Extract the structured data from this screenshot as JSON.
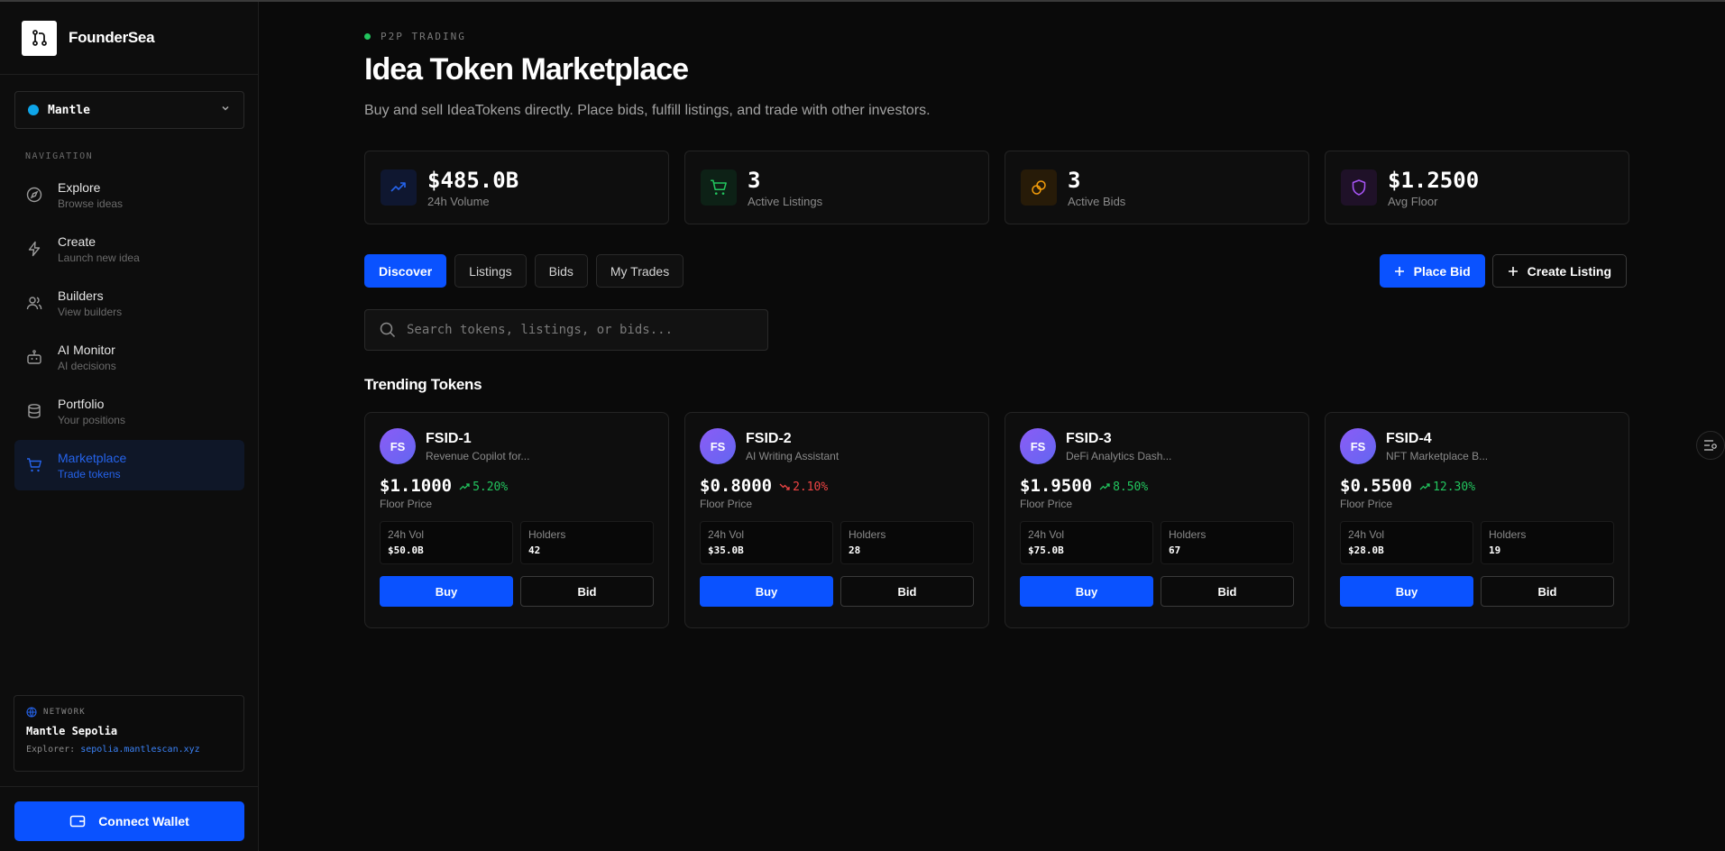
{
  "brand": {
    "name": "FounderSea"
  },
  "chain_selector": {
    "value": "Mantle"
  },
  "navigation": {
    "heading": "NAVIGATION",
    "items": [
      {
        "label": "Explore",
        "sub": "Browse ideas",
        "icon": "compass-icon"
      },
      {
        "label": "Create",
        "sub": "Launch new idea",
        "icon": "bolt-icon"
      },
      {
        "label": "Builders",
        "sub": "View builders",
        "icon": "users-icon"
      },
      {
        "label": "AI Monitor",
        "sub": "AI decisions",
        "icon": "robot-icon"
      },
      {
        "label": "Portfolio",
        "sub": "Your positions",
        "icon": "database-icon"
      },
      {
        "label": "Marketplace",
        "sub": "Trade tokens",
        "icon": "cart-icon"
      }
    ]
  },
  "network": {
    "title": "NETWORK",
    "name": "Mantle Sepolia",
    "explorer_label": "Explorer:",
    "explorer_link": "sepolia.mantlescan.xyz"
  },
  "wallet": {
    "label": "Connect Wallet"
  },
  "page": {
    "eyebrow": "P2P TRADING",
    "title": "Idea Token Marketplace",
    "description": "Buy and sell IdeaTokens directly. Place bids, fulfill listings, and trade with other investors."
  },
  "stats": [
    {
      "value": "$485.0B",
      "label": "24h Volume",
      "icon": "trend-up-icon",
      "color": "#2563eb"
    },
    {
      "value": "3",
      "label": "Active Listings",
      "icon": "cart-icon",
      "color": "#22c55e"
    },
    {
      "value": "3",
      "label": "Active Bids",
      "icon": "coins-icon",
      "color": "#f59e0b"
    },
    {
      "value": "$1.2500",
      "label": "Avg Floor",
      "icon": "shield-icon",
      "color": "#a855f7"
    }
  ],
  "tabs": [
    "Discover",
    "Listings",
    "Bids",
    "My Trades"
  ],
  "actions": {
    "place_bid": "Place Bid",
    "create_listing": "Create Listing"
  },
  "search": {
    "placeholder": "Search tokens, listings, or bids..."
  },
  "trending": {
    "title": "Trending Tokens",
    "floor_label": "Floor Price",
    "vol_label": "24h Vol",
    "holders_label": "Holders",
    "buy_label": "Buy",
    "bid_label": "Bid",
    "tokens": [
      {
        "avatar": "FS",
        "symbol": "FSID-1",
        "name": "Revenue Copilot for...",
        "price": "$1.1000",
        "change": "5.20%",
        "direction": "up",
        "volume": "$50.0B",
        "holders": "42"
      },
      {
        "avatar": "FS",
        "symbol": "FSID-2",
        "name": "AI Writing Assistant",
        "price": "$0.8000",
        "change": "2.10%",
        "direction": "down",
        "volume": "$35.0B",
        "holders": "28"
      },
      {
        "avatar": "FS",
        "symbol": "FSID-3",
        "name": "DeFi Analytics Dash...",
        "price": "$1.9500",
        "change": "8.50%",
        "direction": "up",
        "volume": "$75.0B",
        "holders": "67"
      },
      {
        "avatar": "FS",
        "symbol": "FSID-4",
        "name": "NFT Marketplace B...",
        "price": "$0.5500",
        "change": "12.30%",
        "direction": "up",
        "volume": "$28.0B",
        "holders": "19"
      }
    ]
  }
}
